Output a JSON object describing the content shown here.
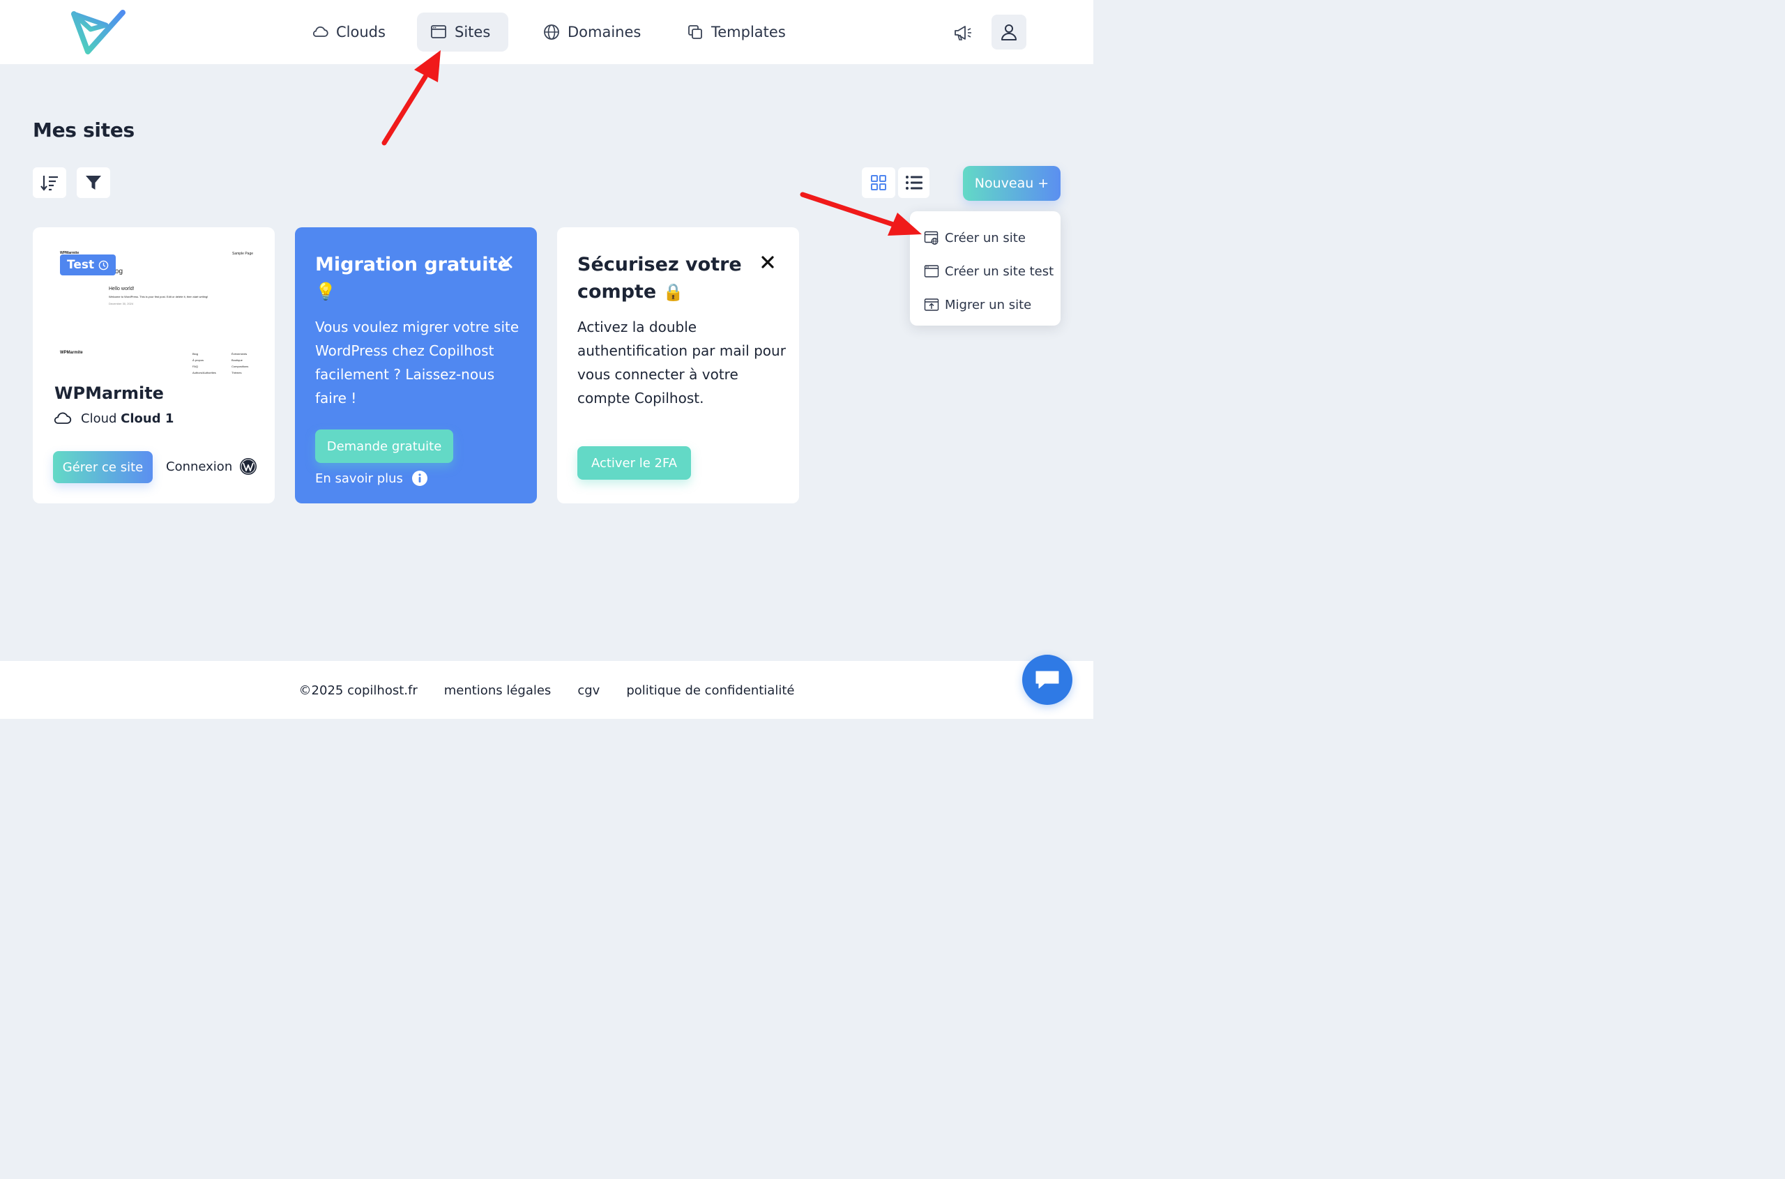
{
  "nav": {
    "clouds": "Clouds",
    "sites": "Sites",
    "domaines": "Domaines",
    "templates": "Templates",
    "active": "Sites"
  },
  "page": {
    "title": "Mes sites",
    "new_button": "Nouveau +"
  },
  "dropdown": {
    "items": [
      "Créer un site",
      "Créer un site test",
      "Migrer un site"
    ]
  },
  "site_card": {
    "preview": {
      "brand": "WPMarmite",
      "sample_page": "Sample Page",
      "blog": "Blog",
      "hello": "Hello world!",
      "excerpt": "Welcome to WordPress. This is your first post. Edit or delete it, then start writing!",
      "date": "December 30, 2024",
      "footer_brand": "WPMarmite",
      "footer_col1": [
        "Blog",
        "À propos",
        "FAQ",
        "Authors/Authorities"
      ],
      "footer_col2": [
        "Évènements",
        "Boutique",
        "Compositions",
        "Thèmes"
      ]
    },
    "badge": "Test",
    "name": "WPMarmite",
    "cloud_prefix": "Cloud",
    "cloud_name": "Cloud 1",
    "manage_button": "Gérer ce site",
    "login_link": "Connexion"
  },
  "migration_card": {
    "title": "Migration gratuite",
    "emoji": "💡",
    "body": "Vous voulez migrer votre site WordPress chez Copilhost facilement ? Laissez-nous faire !",
    "button": "Demande gratuite",
    "learn_more": "En savoir plus"
  },
  "secure_card": {
    "title": "Sécurisez votre compte",
    "emoji": "🔒",
    "body": "Activez la double authentification par mail pour vous connecter à votre compte Copilhost.",
    "button": "Activer le 2FA"
  },
  "footer": {
    "copyright": "©2025 copilhost.fr",
    "legal": "mentions légales",
    "cgv": "cgv",
    "privacy": "politique de confidentialité"
  },
  "colors": {
    "accent_blue": "#5088f1",
    "teal": "#63d9c6",
    "arrow_red": "#f01a1a",
    "chat_blue": "#2f7ae5"
  }
}
